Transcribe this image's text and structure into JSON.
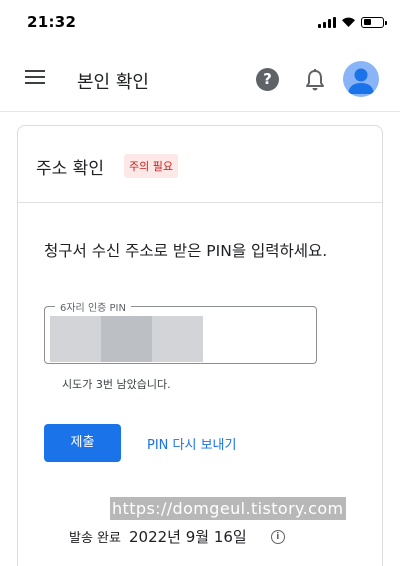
{
  "status_bar": {
    "time": "21:32"
  },
  "app_bar": {
    "title": "본인 확인",
    "icons": [
      "menu-icon",
      "help-icon",
      "bell-icon",
      "avatar-icon"
    ],
    "help_glyph": "?"
  },
  "card": {
    "title": "주소 확인",
    "badge": "주의 필요",
    "instruction": "청구서 수신 주소로 받은 PIN을 입력하세요.",
    "pin_field": {
      "label": "6자리 인증 PIN"
    },
    "attempts_text": "시도가 3번 남았습니다.",
    "submit_label": "제출",
    "resend_label": "PIN 다시 보내기",
    "sent_label": "발송 완료",
    "sent_date": "2022년 9월 16일",
    "info_glyph": "i"
  },
  "watermark": "https://domgeul.tistory.com",
  "colors": {
    "accent": "#1a73e8",
    "badge_bg": "#fce8e6",
    "badge_text": "#c5221f",
    "avatar": "#8ab4f8"
  }
}
